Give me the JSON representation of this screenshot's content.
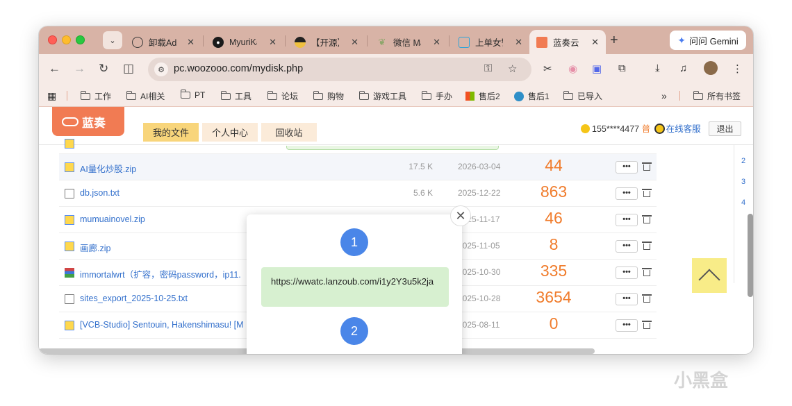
{
  "browser": {
    "tabs": [
      {
        "label": "卸载Ado",
        "icon_color": "#3a3a3a",
        "icon": "openai-icon",
        "active": false
      },
      {
        "label": "MyuriKa",
        "icon_color": "#1a1a1a",
        "icon": "github-icon",
        "active": false
      },
      {
        "label": "【开源】",
        "icon_color": "#222",
        "icon": "half-circle-icon",
        "active": false
      },
      {
        "label": "微信 Ma",
        "icon_color": "#8ea66b",
        "icon": "leaf-icon",
        "active": false
      },
      {
        "label": "上单女警",
        "icon_color": "#2aa3d9",
        "icon": "bilibili-icon",
        "active": false
      },
      {
        "label": "蓝奏云",
        "icon_color": "#f17b53",
        "icon": "lanzou-icon",
        "active": true
      }
    ],
    "new_tab": "+",
    "gemini_label": "问问 Gemini",
    "url": "pc.woozooo.com/mydisk.php"
  },
  "bookmarks": [
    {
      "label": "工作",
      "type": "folder"
    },
    {
      "label": "AI相关",
      "type": "folder"
    },
    {
      "label": "PT",
      "type": "folder"
    },
    {
      "label": "工具",
      "type": "folder"
    },
    {
      "label": "论坛",
      "type": "folder"
    },
    {
      "label": "购物",
      "type": "folder"
    },
    {
      "label": "游戏工具",
      "type": "folder"
    },
    {
      "label": "手办",
      "type": "folder"
    },
    {
      "label": "售后2",
      "type": "windows"
    },
    {
      "label": "售后1",
      "type": "site"
    },
    {
      "label": "已导入",
      "type": "folder"
    }
  ],
  "bookmarks_overflow": "»",
  "all_bookmarks": "所有书签",
  "site": {
    "logo": "蓝奏",
    "nav": [
      {
        "label": "我的文件",
        "selected": true
      },
      {
        "label": "个人中心",
        "selected": false
      },
      {
        "label": "回收站",
        "selected": false
      }
    ],
    "user_id": "155****4477",
    "user_level": "普",
    "service": "在线客服",
    "logout": "退出"
  },
  "files": [
    {
      "name": "AI量化炒股.zip",
      "size": "17.5 K",
      "date": "2026-03-04",
      "downloads": "44",
      "icon": "zip",
      "highlight": true
    },
    {
      "name": "db.json.txt",
      "size": "5.6 K",
      "date": "2025-12-22",
      "downloads": "863",
      "icon": "txt",
      "highlight": false
    },
    {
      "name": "mumuainovel.zip",
      "size": "",
      "date": "2025-11-17",
      "downloads": "46",
      "icon": "zip",
      "highlight": false
    },
    {
      "name": "画廊.zip",
      "size": "",
      "date": "2025-11-05",
      "downloads": "8",
      "icon": "zip",
      "highlight": false
    },
    {
      "name": "immortalwrt（扩容，密码password，ip11.",
      "size": "",
      "date": "2025-10-30",
      "downloads": "335",
      "icon": "rar",
      "highlight": false
    },
    {
      "name": "sites_export_2025-10-25.txt",
      "size": "",
      "date": "2025-10-28",
      "downloads": "3654",
      "icon": "txt",
      "highlight": false
    },
    {
      "name": "[VCB-Studio] Sentouin, Hakenshimasu! [M",
      "size": "",
      "date": "2025-08-11",
      "downloads": "0",
      "icon": "zip",
      "highlight": false
    }
  ],
  "more_label": "•••",
  "right_numbers": [
    "2",
    "3",
    "4"
  ],
  "modal": {
    "step1": "1",
    "link": "https://wwatc.lanzoub.com/i1y2Y3u5k2ja",
    "step2": "2",
    "close": "✕"
  },
  "watermark": "小黑盒"
}
